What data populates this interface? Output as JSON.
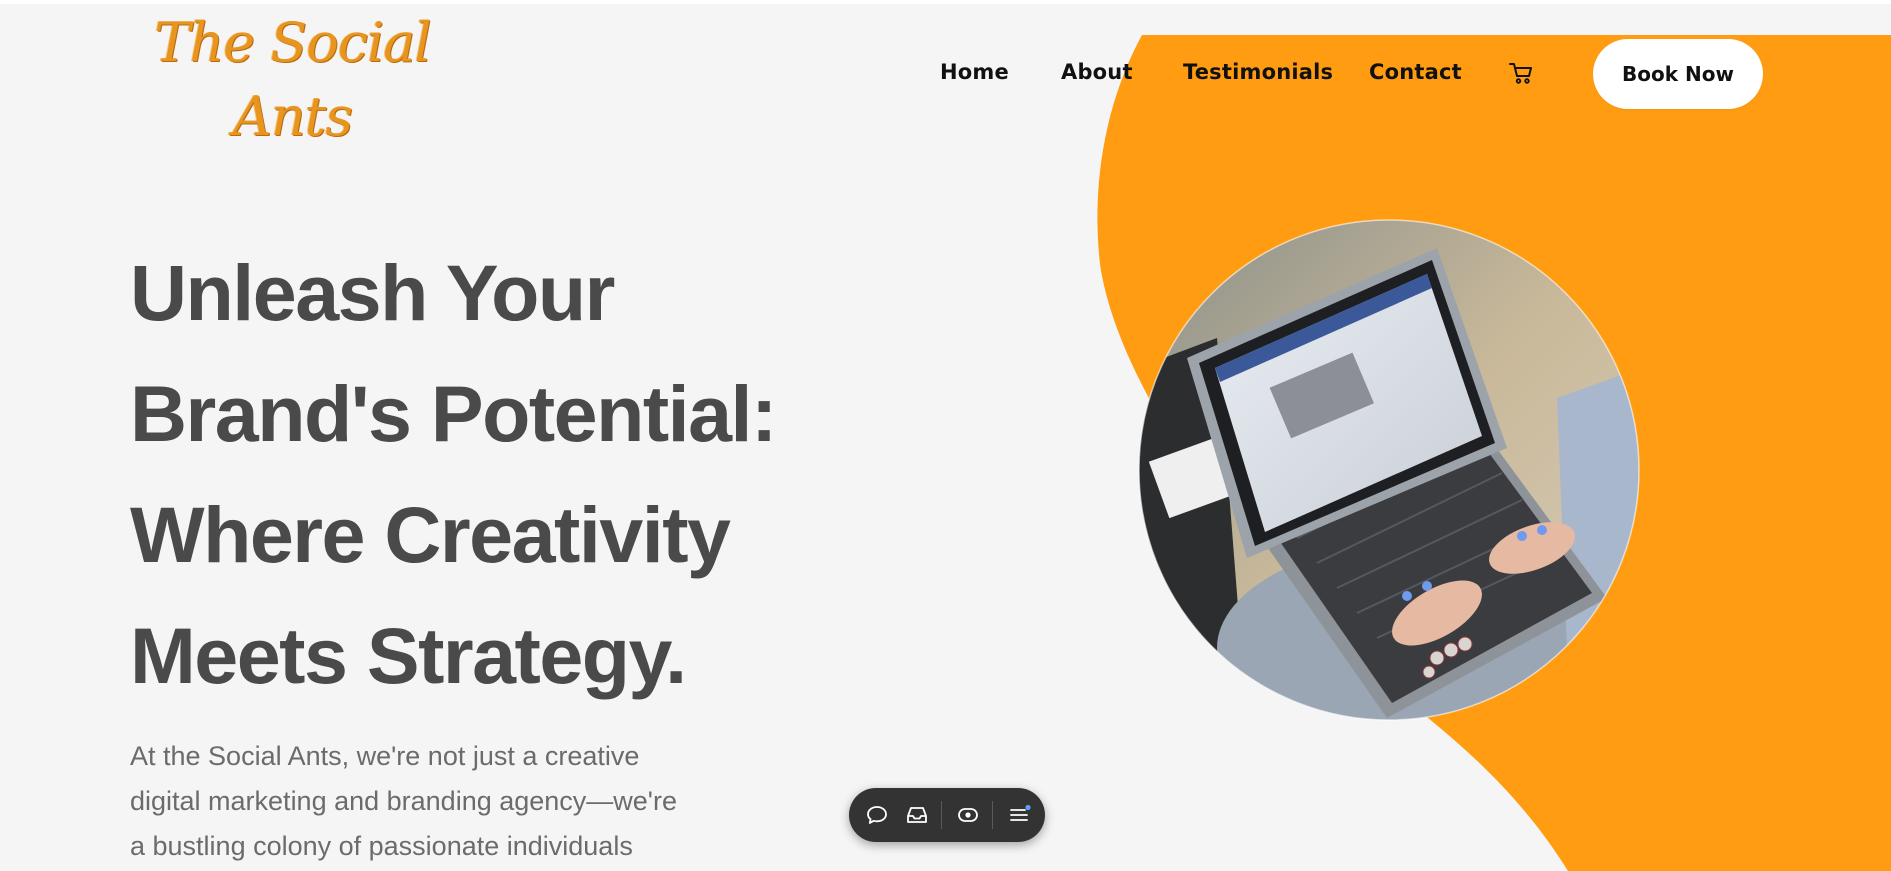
{
  "brand": {
    "logo_line1": "The Social",
    "logo_line2": "Ants",
    "logo_color": "#e8951f"
  },
  "nav": {
    "items": [
      {
        "label": "Home"
      },
      {
        "label": "About"
      },
      {
        "label": "Testimonials"
      },
      {
        "label": "Contact"
      }
    ],
    "cart_icon": "cart-icon",
    "cta_label": "Book Now"
  },
  "hero": {
    "headline_lines": [
      "Unleash Your",
      "Brand's Potential:",
      "Where Creativity",
      "Meets Strategy."
    ],
    "intro_lines": [
      "At the Social Ants, we're not just a creative",
      "digital marketing and branding agency—we're",
      "a bustling colony of passionate individuals"
    ],
    "photo_subject": "person typing on laptop showing social media page"
  },
  "floating_toolbar": {
    "icons": [
      "comment-icon",
      "inbox-icon",
      "eye-icon",
      "menu-icon"
    ]
  },
  "colors": {
    "accent_orange": "#ff9c11",
    "page_background": "#f5f5f5",
    "heading_text": "#4a4a4a",
    "body_text": "#6b6b6b",
    "toolbar_background": "#333333",
    "notification_dot": "#5aa0ff"
  }
}
